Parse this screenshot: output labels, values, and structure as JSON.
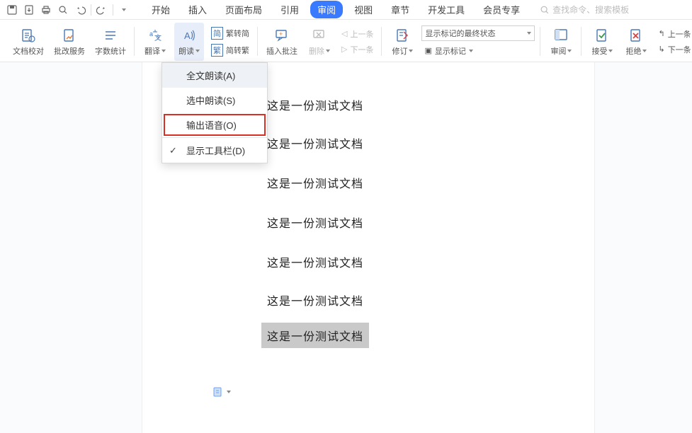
{
  "tabs": {
    "start": "开始",
    "insert": "插入",
    "layout": "页面布局",
    "ref": "引用",
    "review": "审阅",
    "view": "视图",
    "chapter": "章节",
    "dev": "开发工具",
    "member": "会员专享"
  },
  "search": {
    "placeholder": "查找命令、搜索模板"
  },
  "ribbon": {
    "proof": "文档校对",
    "batch": "批改服务",
    "wordcount": "字数统计",
    "translate": "翻译",
    "read": "朗读",
    "t2s": "繁转简",
    "s2t": "简转繁",
    "t2s_icon": "简",
    "s2t_icon": "繁",
    "insertcomment": "插入批注",
    "delete": "删除",
    "prev": "上一条",
    "next": "下一条",
    "track": "修订",
    "displayState": "显示标记的最终状态",
    "showMarkup": "显示标记",
    "reviewPane": "审阅",
    "accept": "接受",
    "reject": "拒绝",
    "cmp_prev": "上一条",
    "cmp_next": "下一条"
  },
  "menu": {
    "readAll": "全文朗读(A)",
    "readSel": "选中朗读(S)",
    "outVoice": "输出语音(O)",
    "toolbar": "显示工具栏(D)"
  },
  "content": {
    "line": "这是一份测试文档"
  }
}
